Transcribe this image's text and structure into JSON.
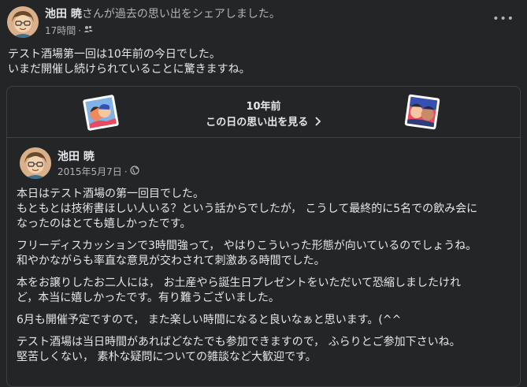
{
  "post": {
    "author": "池田 暁",
    "action": "さんが過去の思い出をシェアしました。",
    "time": "17時間",
    "separator": "·",
    "audience_icon": "friends-icon",
    "more_icon": "more-horizontal-icon",
    "text_lines": [
      "テスト酒場第一回は10年前の今日でした。",
      "いまだ開催し続けられていることに驚きますね。"
    ]
  },
  "memory_card": {
    "years_ago": "10年前",
    "see_memories": "この日の思い出を見る",
    "chevron_icon": "chevron-right-icon",
    "author": "池田 暁",
    "date": "2015年5月7日",
    "separator": "·",
    "privacy_icon": "globe-icon",
    "paragraphs": [
      [
        "本日はテスト酒場の第一回目でした。",
        "もともとは技術書ほしい人いる？という話からでしたが， こうして最終的に5名での飲み会に",
        "なったのはとても嬉しかったです。"
      ],
      [
        "フリーディスカッションで3時間強って， やはりこういった形態が向いているのでしょうね。",
        "和やかながらも率直な意見が交わされて刺激ある時間でした。"
      ],
      [
        "本をお譲りしたお二人には， お土産やら誕生日プレゼントをいただいて恐縮しましたけれ",
        "ど，本当に嬉しかったです。有り難うございました。"
      ],
      [
        "6月も開催予定ですので， また楽しい時間になると良いなぁと思います。(^^"
      ],
      [
        "テスト酒場は当日時間があればどなたでも参加できますので， ふらりとご参加下さいね。",
        "堅苦しくない， 素朴な疑問についての雑談など大歓迎です。"
      ]
    ]
  },
  "colors": {
    "background": "#242526",
    "text_primary": "#e4e6eb",
    "text_secondary": "#b0b3b8",
    "border": "#3e4042"
  }
}
